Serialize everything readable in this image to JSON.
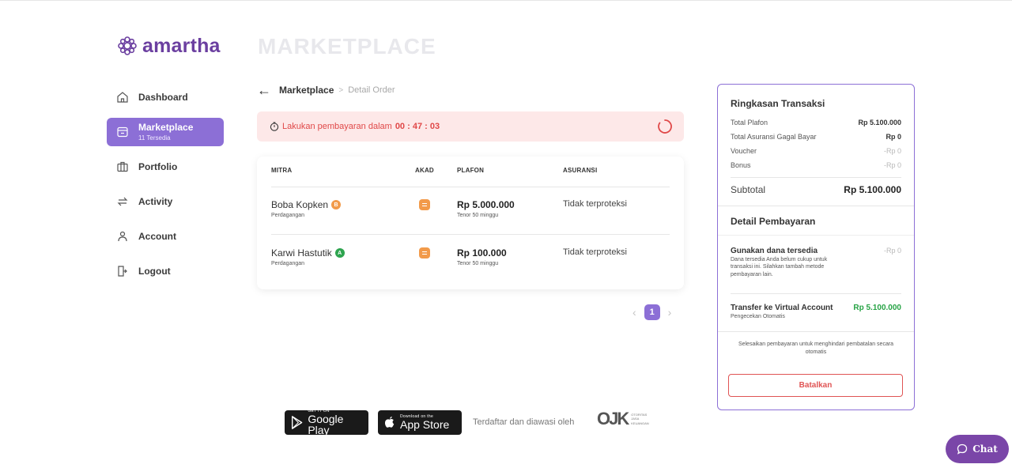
{
  "brand": {
    "name": "amartha",
    "color": "#6b3fa0"
  },
  "page_title": "MARKETPLACE",
  "sidebar": {
    "items": [
      {
        "label": "Dashboard",
        "icon": "home-icon"
      },
      {
        "label": "Marketplace",
        "sub": "11 Tersedia",
        "icon": "store-icon",
        "active": true
      },
      {
        "label": "Portfolio",
        "icon": "briefcase-icon"
      },
      {
        "label": "Activity",
        "icon": "swap-icon"
      },
      {
        "label": "Account",
        "icon": "user-icon"
      },
      {
        "label": "Logout",
        "icon": "logout-icon"
      }
    ]
  },
  "breadcrumb": {
    "current": "Marketplace",
    "separator": ">",
    "detail": "Detail Order"
  },
  "timer": {
    "text": "Lakukan pembayaran dalam",
    "time": "00 : 47 : 03",
    "color": "#e04848"
  },
  "table": {
    "headers": {
      "mitra": "MITRA",
      "akad": "AKAD",
      "plafon": "PLAFON",
      "asuransi": "ASURANSI"
    },
    "rows": [
      {
        "name": "Boba Kopken",
        "grade": "B",
        "grade_color": "#f29a4a",
        "sector": "Perdagangan",
        "plafon": "Rp 5.000.000",
        "tenor": "Tenor 50 minggu",
        "asuransi": "Tidak terproteksi"
      },
      {
        "name": "Karwi Hastutik",
        "grade": "A",
        "grade_color": "#2ea44f",
        "sector": "Perdagangan",
        "plafon": "Rp 100.000",
        "tenor": "Tenor 50 minggu",
        "asuransi": "Tidak terproteksi"
      }
    ]
  },
  "pagination": {
    "current": "1"
  },
  "summary": {
    "title": "Ringkasan Transaksi",
    "rows": [
      {
        "label": "Total Plafon",
        "value": "Rp 5.100.000"
      },
      {
        "label": "Total Asuransi Gagal Bayar",
        "value": "Rp 0"
      },
      {
        "label": "Voucher",
        "value": "-Rp 0"
      },
      {
        "label": "Bonus",
        "value": "-Rp 0"
      }
    ],
    "subtotal_label": "Subtotal",
    "subtotal_value": "Rp 5.100.000",
    "detail_title": "Detail Pembayaran",
    "dana_title": "Gunakan dana tersedia",
    "dana_value": "-Rp 0",
    "dana_desc": "Dana tersedia Anda belum cukup untuk transaksi ini. Silahkan tambah metode pembayaran lain.",
    "va_title": "Transfer ke Virtual Account",
    "va_value": "Rp 5.100.000",
    "va_sub": "Pengecekan Otomatis",
    "notice": "Selesaikan pembayaran untuk menghindari pembatalan secara otomatis",
    "cancel_label": "Batalkan"
  },
  "footer": {
    "google_small": "GET IT ON",
    "google_big": "Google Play",
    "apple_small": "Download on the",
    "apple_big": "App Store",
    "registered_text": "Terdaftar dan diawasi oleh",
    "ojk": "OJK",
    "ojk_lines": [
      "OTORITAS",
      "JASA",
      "KEUANGAN"
    ]
  },
  "chat": {
    "label": "Chat",
    "color": "#7a46a8"
  },
  "accent": "#8c6fd6"
}
